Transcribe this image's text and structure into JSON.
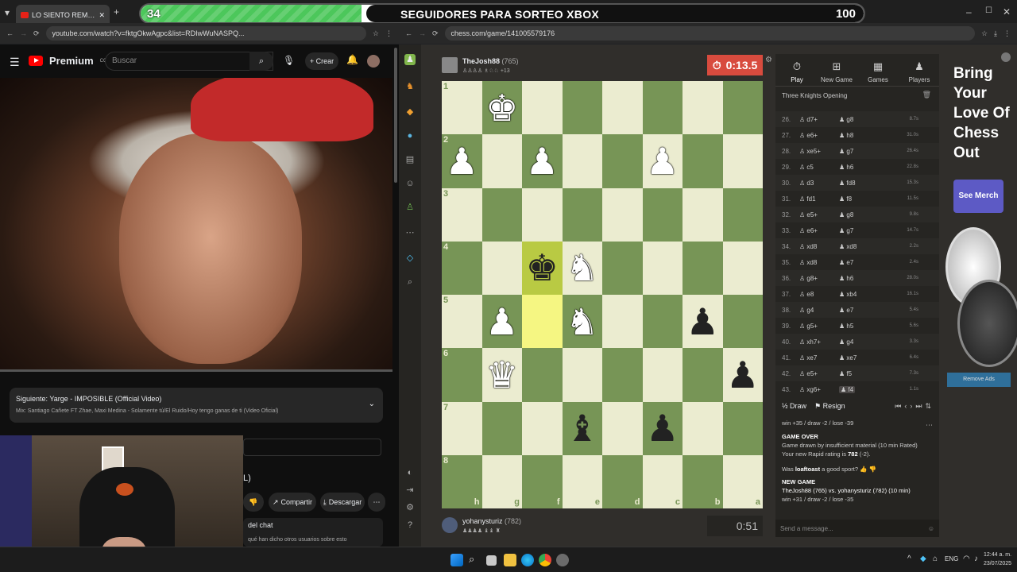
{
  "goal": {
    "current": "34",
    "title": "SEGUIDORES PARA SORTEO XBOX",
    "target": "100",
    "progress": 0.34
  },
  "left_browser": {
    "tab_title": "LO SIENTO REMIX - Milo &...",
    "url": "youtube.com/watch?v=fktgOkwAgpc&list=RDIwWuNASPQ..."
  },
  "right_browser": {
    "url": "chess.com/game/141005579176"
  },
  "youtube": {
    "brand": "Premium",
    "brand_sup": "CO",
    "search_placeholder": "Buscar",
    "create_label": "Crear",
    "next_label": "Siguiente: Yarge - IMPOSIBLE (Official Video)",
    "mix_label": "Mix: Santiago Cañete FT Zhae, Maxi Medina - Solamente tú/El Ruido/Hoy tengo ganas de ti (Video Oficial)",
    "share_label": "Compartir",
    "download_label": "Descargar",
    "chat_label": "del chat",
    "chat_text": "qué han dicho otros usuarios sobre esto",
    "partial_letter": "L)"
  },
  "chess": {
    "top_player": {
      "name": "TheJosh88",
      "rating": "(765)",
      "extra": "+13"
    },
    "bottom_player": {
      "name": "yohanysturiz",
      "rating": "(782)"
    },
    "top_clock": "0:13.5",
    "bottom_clock": "0:51",
    "files": [
      "h",
      "g",
      "f",
      "e",
      "d",
      "c",
      "b",
      "a"
    ],
    "ranks": [
      "1",
      "2",
      "3",
      "4",
      "5",
      "6",
      "7",
      "8"
    ],
    "board": [
      [
        "",
        "wK",
        "",
        "",
        "",
        "",
        "",
        ""
      ],
      [
        "wP",
        "",
        "wP",
        "",
        "",
        "wP",
        "",
        ""
      ],
      [
        "",
        "",
        "",
        "",
        "",
        "",
        "",
        ""
      ],
      [
        "",
        "",
        "bK",
        "wN",
        "",
        "",
        "",
        ""
      ],
      [
        "",
        "wP",
        "",
        "wN",
        "",
        "",
        "bP",
        ""
      ],
      [
        "",
        "wQ",
        "",
        "",
        "",
        "",
        "",
        "bP"
      ],
      [
        "",
        "",
        "",
        "bB",
        "",
        "bP",
        "",
        ""
      ],
      [
        "",
        "",
        "",
        "",
        "",
        "",
        "",
        ""
      ]
    ],
    "highlight": [
      [
        3,
        2
      ],
      [
        4,
        2
      ]
    ],
    "panel_tabs": [
      "Play",
      "New Game",
      "Games",
      "Players"
    ],
    "opening": "Three Knights Opening",
    "moves": [
      {
        "n": "26.",
        "w": "d7+",
        "b": "g8",
        "t": "8.7s"
      },
      {
        "n": "27.",
        "w": "e6+",
        "b": "h8",
        "t": "31.0s"
      },
      {
        "n": "28.",
        "w": "xe5+",
        "b": "g7",
        "t": "26.4s"
      },
      {
        "n": "29.",
        "w": "c5",
        "b": "h6",
        "t": "22.8s"
      },
      {
        "n": "30.",
        "w": "d3",
        "b": "fd8",
        "t": "15.3s"
      },
      {
        "n": "31.",
        "w": "fd1",
        "b": "f8",
        "t": "11.5s"
      },
      {
        "n": "32.",
        "w": "e5+",
        "b": "g8",
        "t": "9.8s"
      },
      {
        "n": "33.",
        "w": "e6+",
        "b": "g7",
        "t": "14.7s"
      },
      {
        "n": "34.",
        "w": "xd8",
        "b": "xd8",
        "t": "2.2s"
      },
      {
        "n": "35.",
        "w": "xd8",
        "b": "e7",
        "t": "2.4s"
      },
      {
        "n": "36.",
        "w": "g8+",
        "b": "h6",
        "t": "28.0s"
      },
      {
        "n": "37.",
        "w": "e8",
        "b": "xb4",
        "t": "16.1s"
      },
      {
        "n": "38.",
        "w": "g4",
        "b": "e7",
        "t": "5.4s"
      },
      {
        "n": "39.",
        "w": "g5+",
        "b": "h5",
        "t": "5.6s"
      },
      {
        "n": "40.",
        "w": "xh7+",
        "b": "g4",
        "t": "3.3s"
      },
      {
        "n": "41.",
        "w": "xe7",
        "b": "xe7",
        "t": "6.4s"
      },
      {
        "n": "42.",
        "w": "e5+",
        "b": "f5",
        "t": "7.3s"
      },
      {
        "n": "43.",
        "w": "xg6+",
        "b": "f4",
        "t": "1.1s"
      }
    ],
    "draw_label": "Draw",
    "resign_label": "Resign",
    "chat": {
      "line0": "win +35 / draw -2 / lose -39",
      "game_over": "GAME OVER",
      "result": "Game drawn by insufficient material (10 min Rated)",
      "rating_prefix": "Your new Rapid rating is ",
      "rating_value": "782",
      "rating_suffix": " (-2).",
      "question_prefix": "Was ",
      "question_name": "loaftoast",
      "question_suffix": " a good sport?",
      "new_game": "NEW GAME",
      "new_game_line": "TheJosh88 (765) vs. yohanysturiz (782) (10 min)",
      "new_game_odds": "win +31 / draw -2 / lose -35",
      "input_placeholder": "Send a message..."
    }
  },
  "ad": {
    "lines": [
      "Bring",
      "Your",
      "Love Of",
      "Chess",
      "Out"
    ],
    "button": "See Merch",
    "remove": "Remove Ads"
  },
  "taskbar": {
    "lang": "ENG",
    "time": "12:44 a. m.",
    "date": "23/07/2025"
  },
  "colors": {
    "goal_fill": "#4cc75b",
    "clock_red": "#d84b3e",
    "board_light": "#ebecd0",
    "board_dark": "#779556",
    "merch": "#5d5ac5"
  }
}
